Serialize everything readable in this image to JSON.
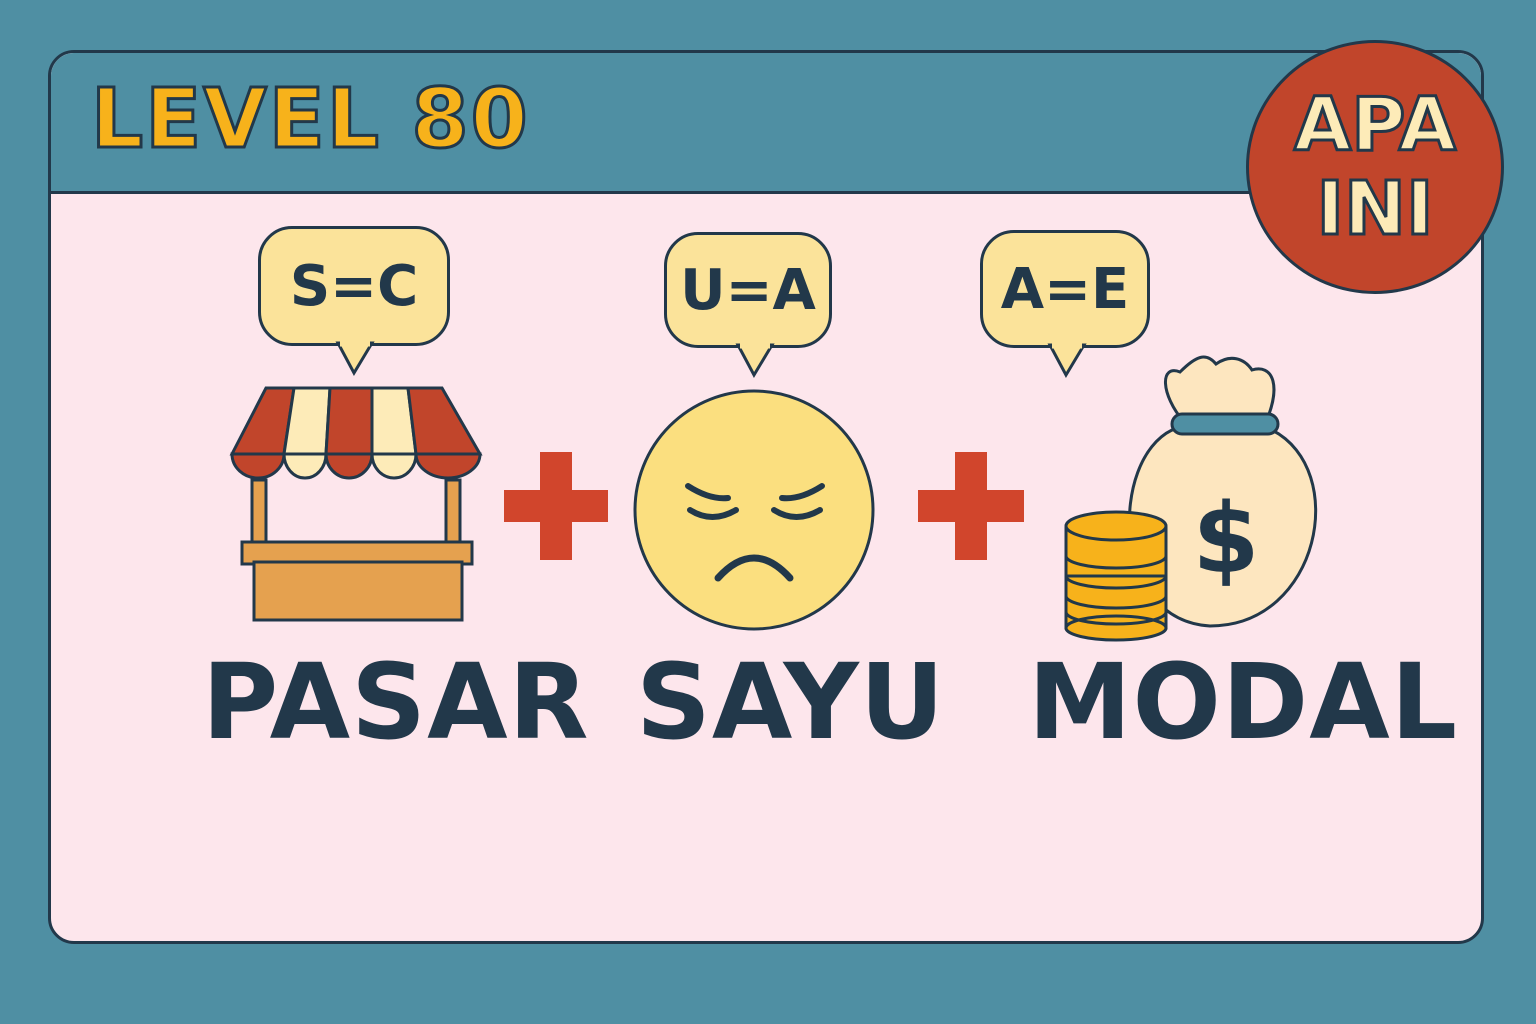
{
  "header": {
    "level_label": "LEVEL 80"
  },
  "badge": {
    "line1": "APA",
    "line2": "INI"
  },
  "clues": [
    {
      "word": "PASAR",
      "hint": "S=C",
      "icon": "market-stall-icon"
    },
    {
      "word": "SAYU",
      "hint": "U=A",
      "icon": "sad-face-icon"
    },
    {
      "word": "MODAL",
      "hint": "A=E",
      "icon": "money-bag-icon"
    }
  ],
  "operator_icon": "plus-icon",
  "colors": {
    "background": "#4f8fa3",
    "card": "#fde6ec",
    "title": "#f7b21b",
    "badge": "#c1452b",
    "bubble": "#fbe39a",
    "plus": "#d1452c",
    "outline": "#22384a"
  }
}
